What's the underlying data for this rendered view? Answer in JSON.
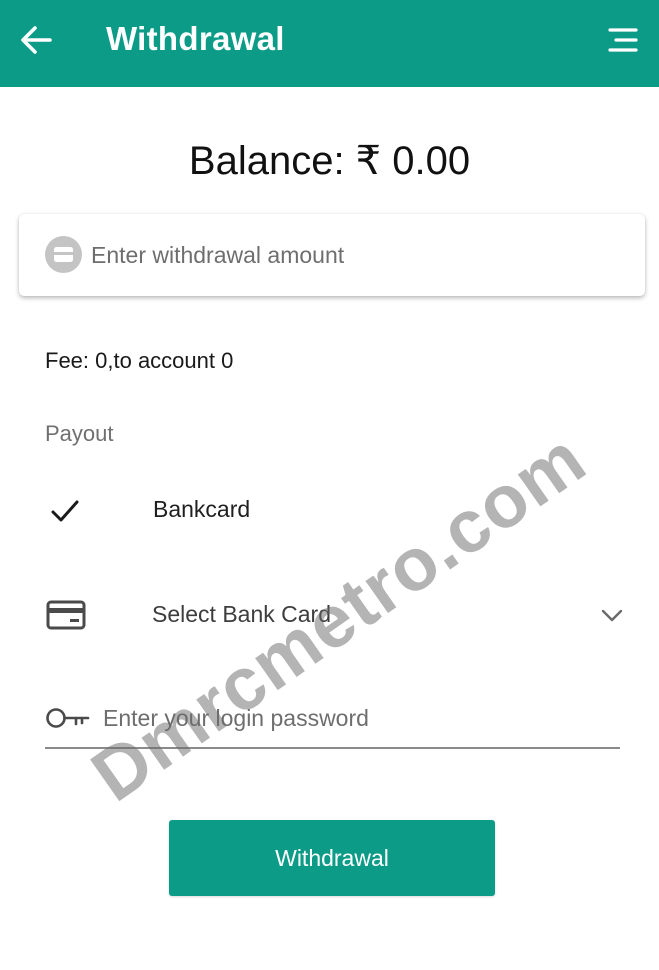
{
  "header": {
    "title": "Withdrawal",
    "back_icon": "arrow-left-icon",
    "menu_icon": "menu-icon",
    "background_color": "#0b9b87"
  },
  "balance": {
    "text": "Balance: ₹ 0.00"
  },
  "amount": {
    "placeholder": "Enter withdrawal amount",
    "value": "",
    "icon": "amount-icon"
  },
  "fee": {
    "text": "Fee: 0,to account 0"
  },
  "payout": {
    "label": "Payout",
    "method": "Bankcard",
    "method_icon": "check-icon",
    "selected": true
  },
  "bank_card": {
    "label": "Select Bank Card",
    "icon": "credit-card-icon",
    "dropdown_icon": "chevron-down-icon"
  },
  "password": {
    "placeholder": "Enter your login password",
    "value": "",
    "icon": "key-icon"
  },
  "submit": {
    "label": "Withdrawal",
    "color": "#0b9b87"
  },
  "watermark": {
    "text": "Dmrcmetro.com"
  }
}
